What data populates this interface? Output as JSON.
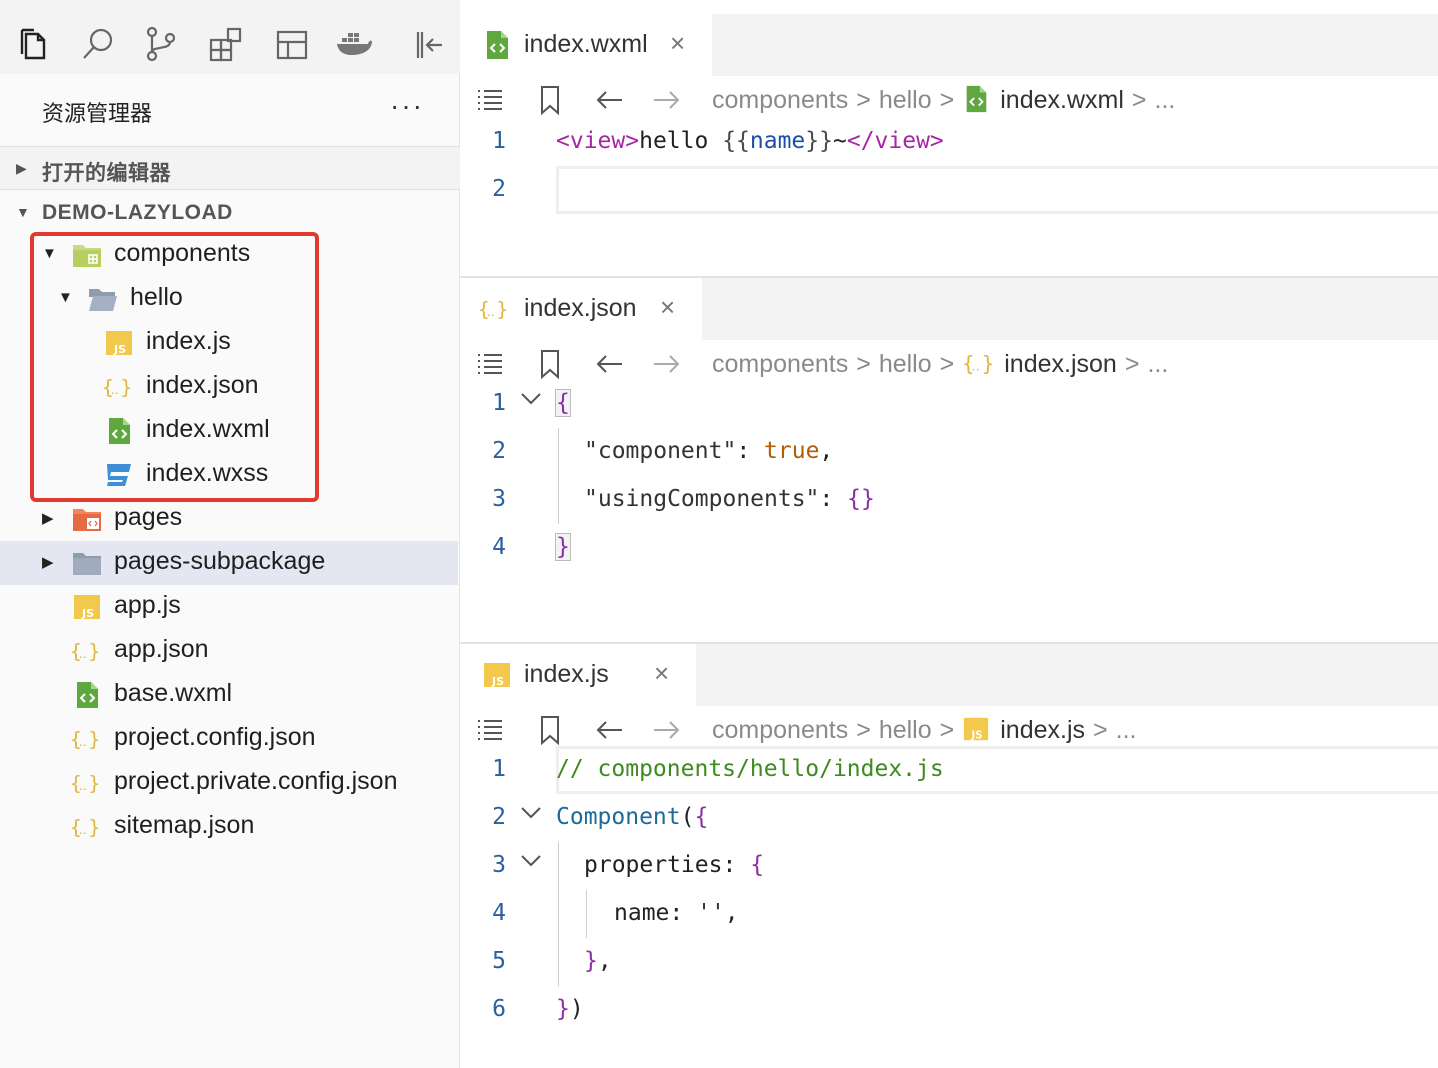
{
  "activity_bar": {
    "icons": [
      "explorer-icon",
      "search-icon",
      "source-control-icon",
      "extensions-icon",
      "layout-icon",
      "docker-icon",
      "collapse-panel-icon"
    ]
  },
  "sidebar": {
    "title": "资源管理器",
    "more": "···",
    "open_editors_label": "打开的编辑器",
    "project_label": "DEMO-LAZYLOAD",
    "tree": [
      {
        "name": "components",
        "type": "folder"
      },
      {
        "name": "hello",
        "type": "folder"
      },
      {
        "name": "index.js",
        "type": "js"
      },
      {
        "name": "index.json",
        "type": "json"
      },
      {
        "name": "index.wxml",
        "type": "wxml"
      },
      {
        "name": "index.wxss",
        "type": "wxss"
      },
      {
        "name": "pages",
        "type": "folder"
      },
      {
        "name": "pages-subpackage",
        "type": "folder",
        "selected": true
      },
      {
        "name": "app.js",
        "type": "js"
      },
      {
        "name": "app.json",
        "type": "json"
      },
      {
        "name": "base.wxml",
        "type": "wxml"
      },
      {
        "name": "project.config.json",
        "type": "json"
      },
      {
        "name": "project.private.config.json",
        "type": "json"
      },
      {
        "name": "sitemap.json",
        "type": "json"
      }
    ]
  },
  "editors": [
    {
      "tab": "index.wxml",
      "close": "×",
      "breadcrumb": {
        "p1": "components",
        "p2": "hello",
        "file": "index.wxml",
        "more": "..."
      },
      "lines": [
        "1",
        "2"
      ]
    },
    {
      "tab": "index.json",
      "close": "×",
      "breadcrumb": {
        "p1": "components",
        "p2": "hello",
        "file": "index.json",
        "more": "..."
      },
      "lines": [
        "1",
        "2",
        "3",
        "4"
      ]
    },
    {
      "tab": "index.js",
      "close": "×",
      "breadcrumb": {
        "p1": "components",
        "p2": "hello",
        "file": "index.js",
        "more": "..."
      },
      "lines": [
        "1",
        "2",
        "3",
        "4",
        "5",
        "6"
      ]
    }
  ],
  "code": {
    "wxml_l1_open": "<view>",
    "wxml_l1_text": "hello ",
    "wxml_l1_must_open": "{{",
    "wxml_l1_var": "name",
    "wxml_l1_must_close": "}}",
    "wxml_l1_tilde": "~",
    "wxml_l1_close": "</view>",
    "json_l1": "{",
    "json_l2_key": "\"component\"",
    "json_l2_colon": ": ",
    "json_l2_val": "true",
    "json_l2_comma": ",",
    "json_l3_key": "\"usingComponents\"",
    "json_l3_colon": ": ",
    "json_l3_val": "{}",
    "json_l4": "}",
    "js_l1": "// components/hello/index.js",
    "js_l2_fn": "Component",
    "js_l2_paren": "(",
    "js_l2_brace": "{",
    "js_l3_prop": "properties",
    "js_l3_colon": ": ",
    "js_l3_brace": "{",
    "js_l4_prop": "name",
    "js_l4_colon": ": ",
    "js_l4_val": "''",
    "js_l4_comma": ",",
    "js_l5_brace": "}",
    "js_l5_comma": ",",
    "js_l6_brace": "}",
    "js_l6_paren": ")"
  }
}
